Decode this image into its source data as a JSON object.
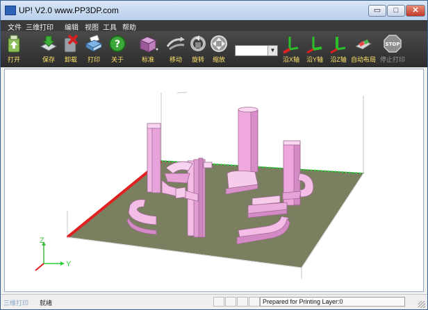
{
  "window": {
    "title": "UP! V2.0 www.PP3DP.com",
    "min_symbol": "▭",
    "max_symbol": "□",
    "close_symbol": "✕"
  },
  "menu": [
    "文件",
    "三维打印",
    "编辑",
    "视图",
    "工具",
    "帮助"
  ],
  "toolbar": {
    "open": "打开",
    "save": "保存",
    "unload": "卸载",
    "print": "打印",
    "about": "关于",
    "standard": "标准",
    "move": "移动",
    "rotate": "旋转",
    "scale": "缩放",
    "along_x": "沿X轴",
    "along_y": "沿Y轴",
    "along_z": "沿Z轴",
    "auto_layout": "自动布局",
    "stop_print": "停止打印",
    "stop_badge": "STOP",
    "combo_value": ""
  },
  "axes": {
    "z": "Z",
    "y": "Y"
  },
  "status": {
    "mode": "三维打印",
    "ready": "就绪",
    "message": "Prepared for Printing Layer:0"
  },
  "colors": {
    "platform": "#7a7f60",
    "part": "#f2b6e4",
    "part_dark": "#c785b8",
    "x_axis": "#e02020",
    "y_axis": "#2bd13a",
    "z_axis": "#3dbd3d",
    "label": "#ffe36b"
  }
}
